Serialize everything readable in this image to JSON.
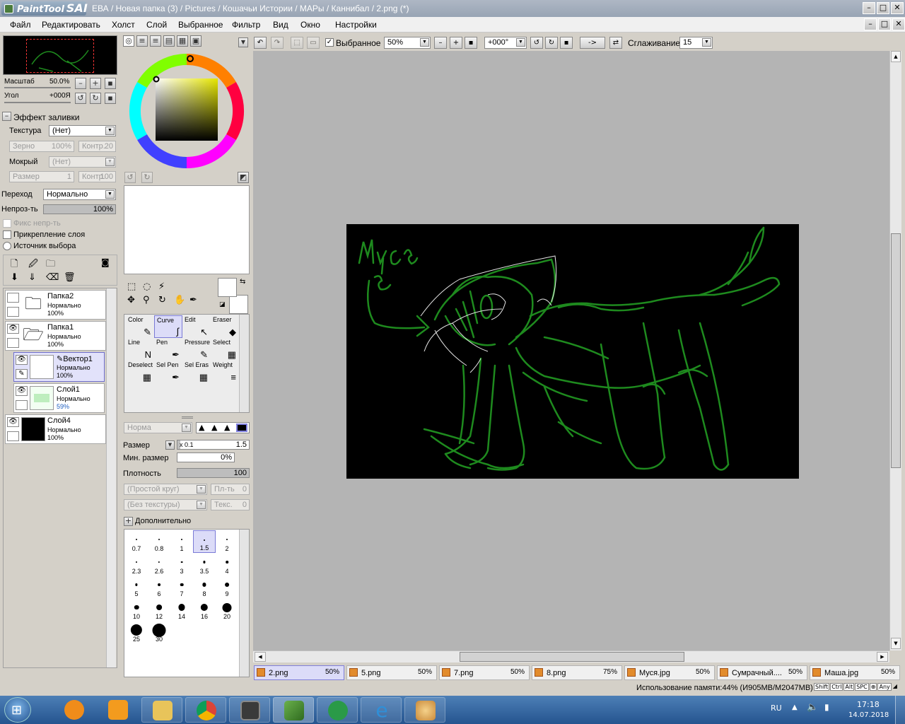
{
  "window": {
    "app_name": "PaintTool",
    "app_brand": "SAI",
    "title": "ЕВА / Новая папка (3) / Pictures / Кошачьи Истории / МАРы / Каннибал / 2.png (*)"
  },
  "menu": [
    "Файл",
    "Редактировать",
    "Холст",
    "Слой",
    "Выбранное",
    "Фильтр",
    "Вид",
    "Окно",
    "Настройки"
  ],
  "navigator": {
    "scale_label": "Масштаб",
    "scale_value": "50.0%",
    "angle_label": "Угол",
    "angle_value": "+000Я"
  },
  "fill_effect": {
    "header": "Эффект заливки",
    "texture_label": "Текстура",
    "texture_value": "(Нет)",
    "grain_label": "Зерно",
    "grain_value": "100%",
    "contrast1_label": "Контр.",
    "contrast1_value": "20",
    "wet_label": "Мокрый",
    "wet_value": "(Нет)",
    "size_label": "Размер",
    "size_value": "1",
    "contrast2_label": "Контр.",
    "contrast2_value": "100"
  },
  "blend": {
    "transition_label": "Переход",
    "transition_value": "Нормально",
    "opacity_label": "Непроз-ть",
    "opacity_value": "100%",
    "opacity_fraction": 1.0,
    "fix_opacity": "Фикс непр-ть",
    "clip_layer": "Прикрепление слоя",
    "selection_source": "Источник выбора"
  },
  "layers": [
    {
      "name": "Папка2",
      "mode": "Нормально",
      "opacity": "100%",
      "type": "folder",
      "visible": false,
      "selected": false
    },
    {
      "name": "Папка1",
      "mode": "Нормально",
      "opacity": "100%",
      "type": "folder",
      "visible": true,
      "selected": false
    },
    {
      "name": "Вектор1",
      "mode": "Нормально",
      "opacity": "100%",
      "type": "vector",
      "visible": true,
      "selected": true
    },
    {
      "name": "Слой1",
      "mode": "Нормально",
      "opacity": "59%",
      "type": "sketch",
      "visible": true,
      "selected": false
    },
    {
      "name": "Слой4",
      "mode": "Нормально",
      "opacity": "100%",
      "type": "black",
      "visible": true,
      "selected": false
    }
  ],
  "tools": [
    {
      "name": "Color",
      "icon": "✎"
    },
    {
      "name": "Curve",
      "icon": "∫",
      "selected": true
    },
    {
      "name": "Edit",
      "icon": "↖"
    },
    {
      "name": "Eraser",
      "icon": "◆"
    },
    {
      "name": "Line",
      "icon": "N"
    },
    {
      "name": "Pen",
      "icon": "✒"
    },
    {
      "name": "Pressure",
      "icon": "✎"
    },
    {
      "name": "Select",
      "icon": "▦"
    },
    {
      "name": "Deselect",
      "icon": "▦"
    },
    {
      "name": "Sel Pen",
      "icon": "✒"
    },
    {
      "name": "Sel Eras",
      "icon": "▦"
    },
    {
      "name": "Weight",
      "icon": "≡"
    }
  ],
  "brush_settings": {
    "mode_value": "Норма",
    "size_label": "Размер",
    "size_mult": "x 0.1",
    "size_value": "1.5",
    "min_size_label": "Мин. размер",
    "min_size_value": "0%",
    "density_label": "Плотность",
    "density_value": "100",
    "shape_value": "(Простой круг)",
    "shape_amount_label": "Пл-ть",
    "shape_amount_value": "0",
    "texture_value": "(Без текстуры)",
    "texture_amount_label": "Текс.",
    "texture_amount_value": "0",
    "advanced_label": "Дополнительно"
  },
  "brush_sizes": [
    "0.7",
    "0.8",
    "1",
    "1.5",
    "2",
    "2.3",
    "2.6",
    "3",
    "3.5",
    "4",
    "5",
    "6",
    "7",
    "8",
    "9",
    "10",
    "12",
    "14",
    "16",
    "20",
    "25",
    "30"
  ],
  "brush_selected": "1.5",
  "toolbar": {
    "selection_label": "Выбранное",
    "zoom_value": "50%",
    "angle_value": "+000°",
    "arrow_label": "->",
    "smoothing_label": "Сглаживание",
    "smoothing_value": "15"
  },
  "tabs": [
    {
      "name": "2.png",
      "zoom": "50%",
      "selected": true
    },
    {
      "name": "5.png",
      "zoom": "50%"
    },
    {
      "name": "7.png",
      "zoom": "50%"
    },
    {
      "name": "8.png",
      "zoom": "75%"
    },
    {
      "name": "Муся.jpg",
      "zoom": "50%"
    },
    {
      "name": "Сумрачный....",
      "zoom": "50%"
    },
    {
      "name": "Маша.jpg",
      "zoom": "50%"
    }
  ],
  "status": {
    "memory": "Использование памяти:44% (И905MB/M2047MB)",
    "keys": [
      "Shift",
      "Ctrl",
      "Alt",
      "SPC",
      "Any"
    ]
  },
  "taskbar": {
    "lang": "RU",
    "time": "17:18",
    "date": "14.07.2018"
  },
  "canvas_text": "Муся и",
  "colors": {
    "accent": "#7a7ad6",
    "canvas_bg": "#000000",
    "stroke": "#1e8a1e",
    "workspace": "#b4b4b4"
  }
}
